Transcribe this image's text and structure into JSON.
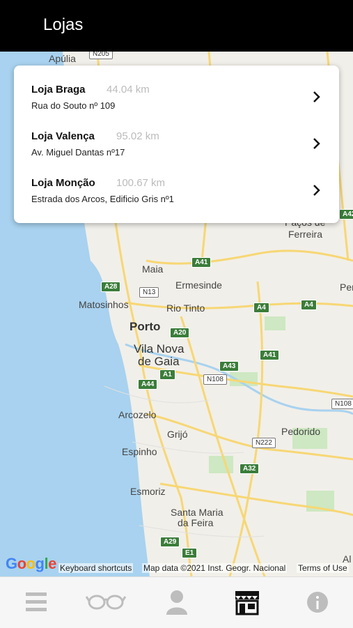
{
  "header": {
    "title": "Lojas"
  },
  "stores": [
    {
      "name": "Loja Braga",
      "distance": "44.04 km",
      "address": "Rua do Souto nº 109"
    },
    {
      "name": "Loja Valença",
      "distance": "95.02 km",
      "address": "Av. Miguel Dantas nº17"
    },
    {
      "name": "Loja Monção",
      "distance": "100.67 km",
      "address": "Estrada dos Arcos, Edificio Gris nº1"
    }
  ],
  "map": {
    "places": [
      "Apúlia",
      "Maia",
      "Ermesinde",
      "Matosinhos",
      "Rio Tinto",
      "Porto",
      "Vila Nova",
      "de Gaia",
      "Arcozelo",
      "Grijó",
      "Espinho",
      "Pedorido",
      "Esmoriz",
      "Santa Maria",
      "da Feira",
      "Paços de",
      "Ferreira",
      "Per",
      "Al"
    ],
    "roads": [
      "N205",
      "A41",
      "A28",
      "N13",
      "A4",
      "A4",
      "A20",
      "A41",
      "A43",
      "A1",
      "A44",
      "N108",
      "N108",
      "N222",
      "A32",
      "A29",
      "E1",
      "A42"
    ],
    "attribution": {
      "logo": "Google",
      "shortcuts": "Keyboard shortcuts",
      "data": "Map data ©2021 Inst. Geogr. Nacional",
      "terms": "Terms of Use"
    },
    "colors": {
      "land": "#f1efe9",
      "water": "#a8d2ef",
      "road": "#f7d774",
      "park": "#cde8c2"
    }
  },
  "tabbar": {
    "active_tab": "stores",
    "icons": [
      "menu-icon",
      "glasses-icon",
      "user-icon",
      "store-icon",
      "info-icon"
    ]
  }
}
